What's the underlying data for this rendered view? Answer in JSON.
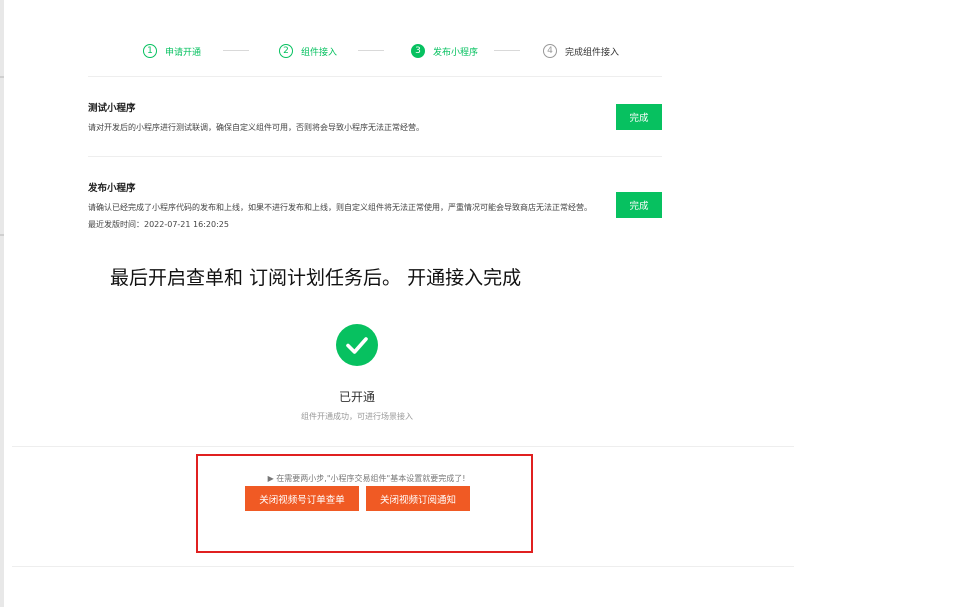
{
  "steps": [
    {
      "number": "1",
      "label": "申请开通",
      "state": "done"
    },
    {
      "number": "2",
      "label": "组件接入",
      "state": "done"
    },
    {
      "number": "3",
      "label": "发布小程序",
      "state": "active"
    },
    {
      "number": "4",
      "label": "完成组件接入",
      "state": "todo"
    }
  ],
  "test_section": {
    "title": "测试小程序",
    "description": "请对开发后的小程序进行测试联调，确保自定义组件可用，否则将会导致小程序无法正常经营。",
    "button": "完成"
  },
  "publish_section": {
    "title": "发布小程序",
    "description": "请确认已经完成了小程序代码的发布和上线，如果不进行发布和上线，则自定义组件将无法正常使用，严重情况可能会导致商店无法正常经营。",
    "last_publish": "最近发版时间：2022-07-21 16:20:25",
    "button": "完成"
  },
  "headline": "最后开启查单和 订阅计划任务后。 开通接入完成",
  "success": {
    "title": "已开通",
    "subtitle": "组件开通成功，可进行场景接入"
  },
  "action_box": {
    "hint": "▶ 在需要两小步,\"小程序交易组件\"基本设置就要完成了!",
    "button_order": "关闭视频号订单查单",
    "button_subscribe": "关闭视频订阅通知"
  },
  "colors": {
    "primary_green": "#07c160",
    "action_orange": "#f05a24",
    "highlight_red": "#e02020"
  }
}
